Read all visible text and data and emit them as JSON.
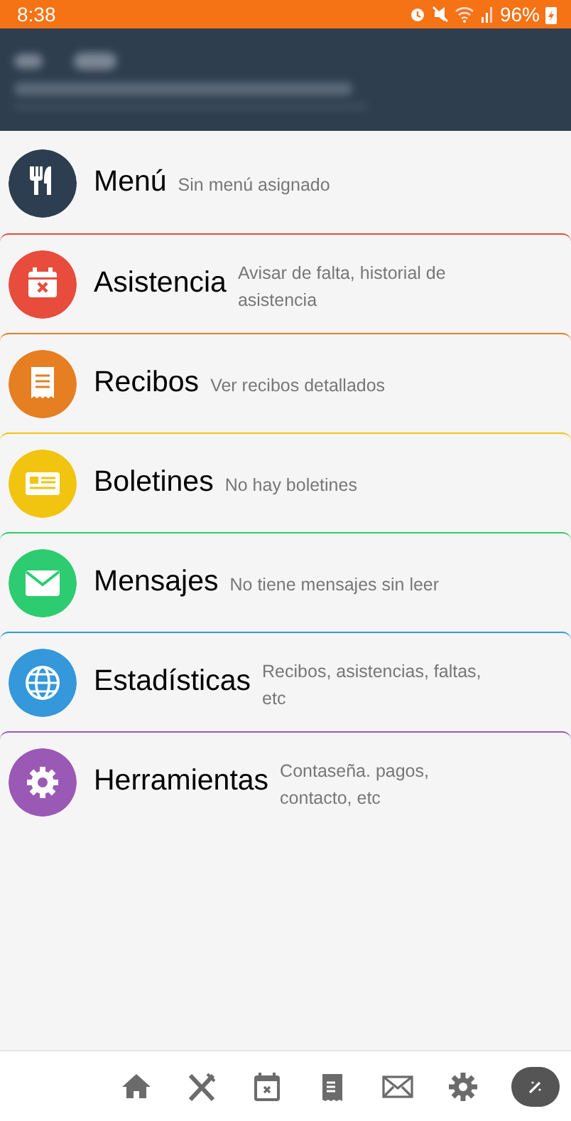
{
  "status_bar": {
    "time": "8:38",
    "battery": "96%"
  },
  "items": [
    {
      "title": "Menú",
      "subtitle": "Sin menú asignado",
      "color": "#2c3e50"
    },
    {
      "title": "Asistencia",
      "subtitle": "Avisar de falta, historial de asistencia",
      "color": "#e74c3c"
    },
    {
      "title": "Recibos",
      "subtitle": "Ver recibos detallados",
      "color": "#e67e22"
    },
    {
      "title": "Boletines",
      "subtitle": "No hay boletines",
      "color": "#f1c40f"
    },
    {
      "title": "Mensajes",
      "subtitle": "No tiene mensajes sin leer",
      "color": "#2ecc71"
    },
    {
      "title": "Estadísticas",
      "subtitle": "Recibos, asistencias, faltas, etc",
      "color": "#3498db"
    },
    {
      "title": "Herramientas",
      "subtitle": "Contaseña. pagos, contacto, etc",
      "color": "#9b59b6"
    }
  ]
}
